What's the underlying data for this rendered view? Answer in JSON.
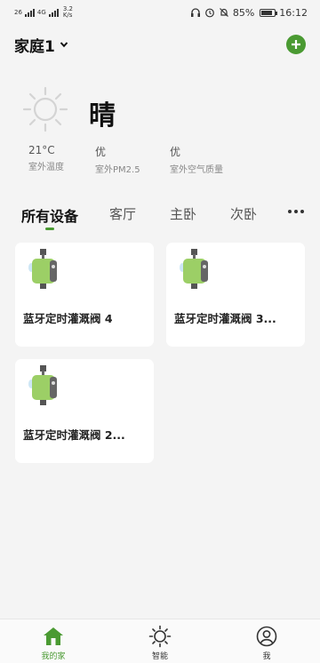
{
  "status_bar": {
    "signal1": "26",
    "signal2": "4G",
    "speed_value": "3.2",
    "speed_unit": "K/s",
    "battery_text": "85%",
    "battery_level": 0.85,
    "time": "16:12"
  },
  "header": {
    "home_name": "家庭1",
    "chevron": "chevron-down-icon",
    "add_icon": "plus-icon"
  },
  "weather": {
    "icon": "sun-icon",
    "condition": "晴",
    "stats": [
      {
        "value": "21°C",
        "label": "室外温度"
      },
      {
        "value": "优",
        "label": "室外PM2.5"
      },
      {
        "value": "优",
        "label": "室外空气质量"
      }
    ]
  },
  "tabs": [
    "所有设备",
    "客厅",
    "主卧",
    "次卧"
  ],
  "devices": [
    {
      "name": "蓝牙定时灌溉阀 4",
      "icon": "water-valve-icon"
    },
    {
      "name": "蓝牙定时灌溉阀 3...",
      "icon": "water-valve-icon"
    },
    {
      "name": "蓝牙定时灌溉阀 2...",
      "icon": "water-valve-icon"
    }
  ],
  "nav": [
    {
      "label": "我的家",
      "icon": "home-icon"
    },
    {
      "label": "智能",
      "icon": "sun-icon"
    },
    {
      "label": "我",
      "icon": "user-icon"
    }
  ],
  "colors": {
    "accent": "#4a9a32",
    "background": "#f4f4f4",
    "card": "#ffffff"
  }
}
